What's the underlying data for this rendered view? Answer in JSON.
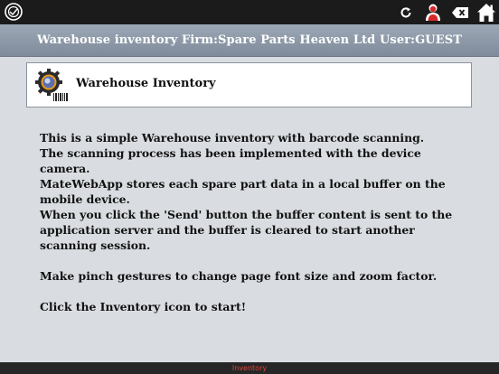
{
  "topbar": {
    "logo_icon": "app-logo-icon",
    "icons": [
      "refresh-icon",
      "user-icon",
      "clear-icon",
      "home-icon"
    ]
  },
  "title_bar": {
    "text": "Warehouse inventory Firm:Spare Parts Heaven Ltd User:GUEST"
  },
  "card": {
    "icon": "inventory-barcode-icon",
    "title": "Warehouse Inventory"
  },
  "content": {
    "paragraph1": "This is a simple Warehouse inventory with barcode scanning.",
    "paragraph2": "The scanning process has been implemented with the device camera.",
    "paragraph3": "MateWebApp stores each spare part data in a local buffer on the mobile device.",
    "paragraph4": "When you click the 'Send' button the buffer content is sent to the application server and the buffer is cleared to start another scanning session.",
    "paragraph5": "Make pinch gestures to change page font size and zoom factor.",
    "paragraph6": "Click the Inventory icon to start!"
  },
  "footer": {
    "active_tab": "Inventory"
  },
  "colors": {
    "topbar_bg": "#1b1b1b",
    "titlebar_bg": "#8f9baa",
    "page_bg": "#d9dce0",
    "footer_bg": "#262626",
    "footer_active": "#e0453a",
    "user_icon_accent": "#d62828"
  }
}
